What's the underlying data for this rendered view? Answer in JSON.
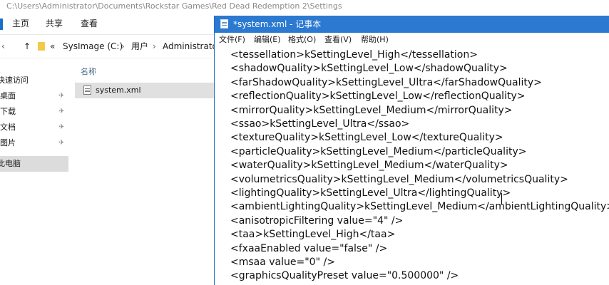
{
  "explorer": {
    "path_title": "C:\\Users\\Administrator\\Documents\\Rockstar Games\\Red Dead Redemption 2\\Settings",
    "ribbon_tabs": [
      "主页",
      "共享",
      "查看"
    ],
    "address": {
      "back": "‹",
      "up": "↑",
      "chevrons": "«",
      "drive": "SysImage (C:)",
      "sep1": "›",
      "users": "用户",
      "sep2": "›",
      "admin": "Administrator"
    },
    "nav": {
      "quick_access": "快速访问",
      "items": [
        {
          "label": "桌面",
          "pin": "✈"
        },
        {
          "label": "下载",
          "pin": "✈"
        },
        {
          "label": "文档",
          "pin": "✈"
        },
        {
          "label": "图片",
          "pin": "✈"
        }
      ],
      "this_pc": "此电脑"
    },
    "files": {
      "column_name": "名称",
      "rows": [
        {
          "name": "system.xml"
        }
      ]
    }
  },
  "notepad": {
    "title": "*system.xml - 记事本",
    "menu": [
      "文件(F)",
      "编辑(E)",
      "格式(O)",
      "查看(V)",
      "帮助(H)"
    ],
    "lines": [
      "<tessellation>kSettingLevel_High</tessellation>",
      "<shadowQuality>kSettingLevel_Low</shadowQuality>",
      "<farShadowQuality>kSettingLevel_Ultra</farShadowQuality>",
      "<reflectionQuality>kSettingLevel_Low</reflectionQuality>",
      "<mirrorQuality>kSettingLevel_Medium</mirrorQuality>",
      "<ssao>kSettingLevel_Ultra</ssao>",
      "<textureQuality>kSettingLevel_Low</textureQuality>",
      "<particleQuality>kSettingLevel_Medium</particleQuality>",
      "<waterQuality>kSettingLevel_Medium</waterQuality>",
      "<volumetricsQuality>kSettingLevel_Medium</volumetricsQuality>",
      "<lightingQuality>kSettingLevel_Ultra</lightingQuality>",
      "<ambientLightingQuality>kSettingLevel_Medium</ambientLightingQuality>",
      "<anisotropicFiltering value=\"4\" />",
      "<taa>kSettingLevel_High</taa>",
      "<fxaaEnabled value=\"false\" />",
      "<msaa value=\"0\" />",
      "<graphicsQualityPreset value=\"0.500000\" />"
    ]
  }
}
